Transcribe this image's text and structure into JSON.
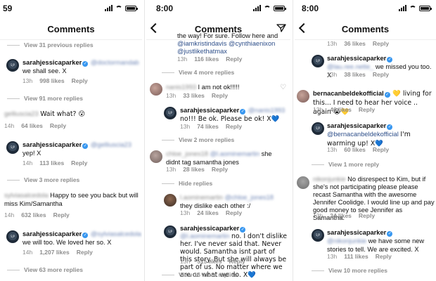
{
  "panels": [
    {
      "time": "59",
      "title": "Comments",
      "entries": [
        {
          "kind": "more",
          "text": "View 31 previous replies"
        },
        {
          "kind": "comment",
          "user": "sarahjessicaparker",
          "verified": true,
          "mention": "@doctormandab",
          "text": "we shall see. X",
          "time": "13h",
          "likes": "998 likes",
          "reply": "Reply"
        },
        {
          "kind": "more",
          "text": "View 91 more replies"
        },
        {
          "kind": "comment",
          "user": "gelliuscia23",
          "verified": false,
          "mention": "",
          "text": "Wait what? 😮",
          "time": "14h",
          "likes": "64 likes",
          "reply": "Reply"
        },
        {
          "kind": "comment",
          "user": "sarahjessicaparker",
          "verified": true,
          "mention": "@gelliuscia23",
          "text": "yep! X",
          "time": "14h",
          "likes": "113 likes",
          "reply": "Reply"
        },
        {
          "kind": "more",
          "text": "View 3 more replies"
        },
        {
          "kind": "comment",
          "user": "sylviasalcedola",
          "verified": false,
          "mention": "",
          "text": "Happy to see you back but will miss Kim/Samantha",
          "time": "14h",
          "likes": "632 likes",
          "reply": "Reply"
        },
        {
          "kind": "comment",
          "user": "sarahjessicaparker",
          "verified": true,
          "mention": "@sylviasalcedola",
          "text": "we will too. We loved her so. X",
          "time": "14h",
          "likes": "1,207 likes",
          "reply": "Reply"
        },
        {
          "kind": "more",
          "text": "View 63 more replies"
        }
      ]
    },
    {
      "time": "8:00",
      "title": "Comments",
      "entries": [
        {
          "kind": "cont",
          "text": "the way! For sure. Follow here and",
          "m1": "@iamkristindavis",
          "m2": "@cynthiaenixon",
          "m3": "@justlikethatmax",
          "time": "13h",
          "likes": "116 likes",
          "reply": "Reply"
        },
        {
          "kind": "more",
          "text": "View 4 more replies"
        },
        {
          "kind": "comment",
          "user": "nanis1993",
          "verified": false,
          "mention": "",
          "text": "I am not ok!!!!!",
          "time": "13h",
          "likes": "33 likes",
          "reply": "Reply"
        },
        {
          "kind": "comment",
          "user": "sarahjessicaparker",
          "verified": true,
          "mention": "@nanis1993",
          "text": "no!!! Be ok. Please be ok! X💙",
          "time": "13h",
          "likes": "74 likes",
          "reply": "Reply"
        },
        {
          "kind": "more",
          "text": "View 2 more replies"
        },
        {
          "kind": "comment",
          "user": "chloe_jones18",
          "verified": false,
          "mention": "@l.aominemartin",
          "text": "she didnt tag samantha jones",
          "time": "13h",
          "likes": "28 likes",
          "reply": "Reply"
        },
        {
          "kind": "hide",
          "text": "Hide replies"
        },
        {
          "kind": "comment",
          "user": "l.aominemartin",
          "verified": false,
          "mention": "@chloe_jones18",
          "text": "they dislike each other :/",
          "time": "13h",
          "likes": "24 likes",
          "reply": "Reply"
        },
        {
          "kind": "comment",
          "user": "sarahjessicaparker",
          "verified": true,
          "mention": "@l.aominemartin",
          "text": "no. I don't dislike her. I've never said that. Never would. Samantha isnt part of this story. But she will always be part of us. No matter where we are or what we do. X💙",
          "time": "13h",
          "likes": "515 likes",
          "reply": "Reply"
        },
        {
          "kind": "more",
          "text": "View 16 more replies"
        }
      ]
    },
    {
      "time": "8:00",
      "title": "Comments",
      "entries": [
        {
          "kind": "topmeta",
          "time": "13h",
          "likes": "36 likes",
          "reply": "Reply"
        },
        {
          "kind": "comment",
          "user": "sarahjessicaparker",
          "verified": true,
          "mention": "@lau.ree.nette_",
          "text": "we missed you too. X",
          "time": "13h",
          "likes": "38 likes",
          "reply": "Reply"
        },
        {
          "kind": "comment",
          "user": "bernacanbeldekofficial",
          "verified": true,
          "mention": "",
          "text": "💛 living for this... I need to hear her voice .. again 😭💛",
          "time": "13h",
          "likes": "46 likes",
          "reply": "Reply"
        },
        {
          "kind": "comment",
          "user": "sarahjessicaparker",
          "verified": true,
          "mention": "@bernacanbeldekofficial",
          "text": "I'm warming up! X💙",
          "time": "13h",
          "likes": "60 likes",
          "reply": "Reply"
        },
        {
          "kind": "more",
          "text": "View 1 more reply"
        },
        {
          "kind": "comment",
          "user": "nikonjunkie",
          "verified": false,
          "mention": "",
          "text": "No disrespect to Kim, but if she's not participating please please recast Samantha with the awesome Jennifer Coolidge. I would line up and pay good money to see Jennifer as Samantha.",
          "time": "13h",
          "likes": "34 likes",
          "reply": "Reply"
        },
        {
          "kind": "comment",
          "user": "sarahjessicaparker",
          "verified": true,
          "mention": "@nikonjunkie",
          "text": "we have some new stories to tell. We are excited. X",
          "time": "13h",
          "likes": "111 likes",
          "reply": "Reply"
        },
        {
          "kind": "more",
          "text": "View 10 more replies"
        }
      ]
    }
  ]
}
